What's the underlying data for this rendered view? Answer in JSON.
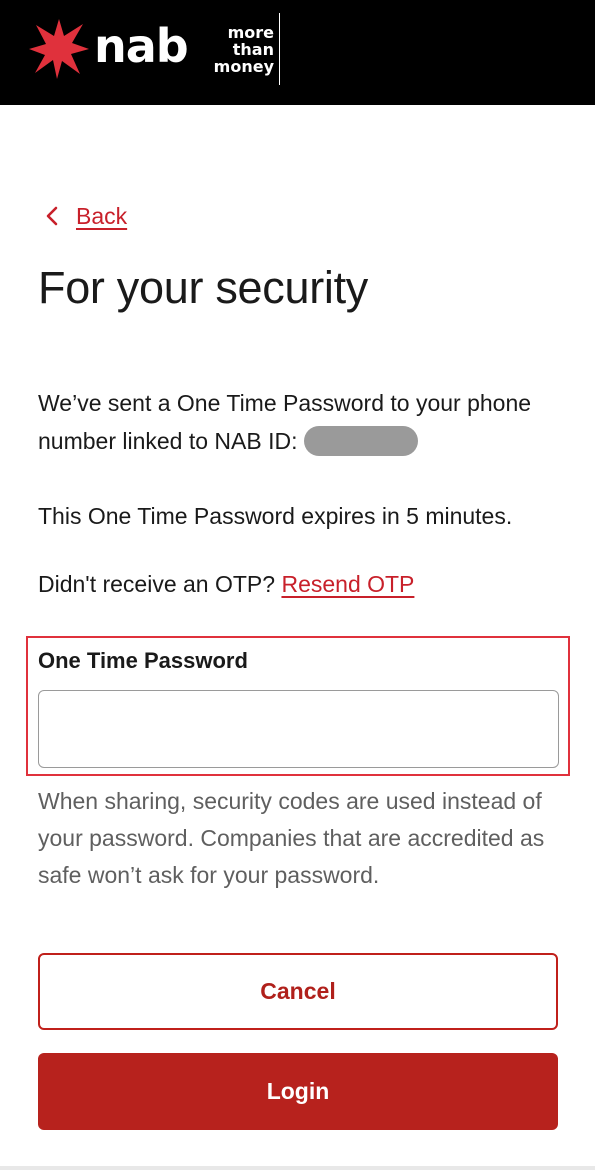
{
  "brand": {
    "logo_text": "nab",
    "tagline_lines": [
      "more",
      "than",
      "money"
    ],
    "primary_color": "#b7221d",
    "link_color": "#c8202a",
    "star_color": "#e0313c"
  },
  "nav": {
    "back_label": "Back",
    "back_icon": "chevron-left-icon"
  },
  "page": {
    "title": "For your security",
    "sent_text": "We’ve sent a One Time Password to your phone number linked to NAB ID:",
    "expiry_text": "This One Time Password expires in 5 minutes.",
    "resend_prompt": "Didn't receive an OTP?",
    "resend_link": "Resend OTP"
  },
  "otp": {
    "label": "One Time Password",
    "value": "",
    "placeholder": ""
  },
  "helper_text": "When sharing, security codes are used instead of your password. Companies that are accredited as safe won’t ask for your password.",
  "actions": {
    "cancel_label": "Cancel",
    "login_label": "Login"
  }
}
